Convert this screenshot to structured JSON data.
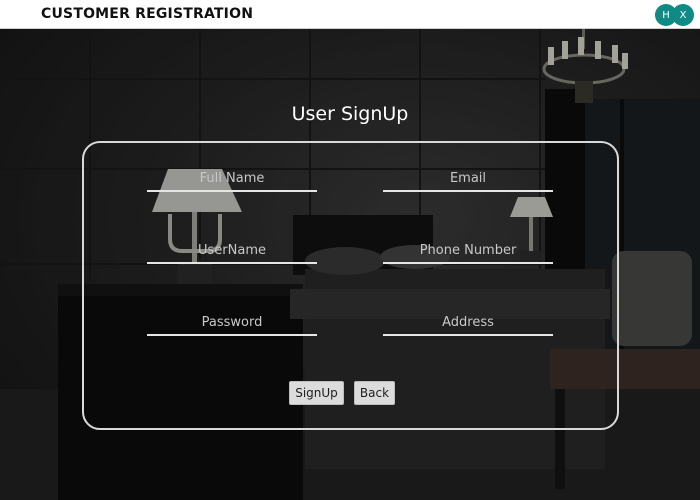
{
  "window": {
    "title": "CUSTOMER REGISTRATION",
    "hide_label": "H",
    "close_label": "X",
    "accent_color": "#0f8a84"
  },
  "form": {
    "heading": "User SignUp",
    "fields": {
      "full_name": {
        "placeholder": "Full Name",
        "value": ""
      },
      "email": {
        "placeholder": "Email",
        "value": ""
      },
      "username": {
        "placeholder": "UserName",
        "value": ""
      },
      "phone": {
        "placeholder": "Phone Number",
        "value": ""
      },
      "password": {
        "placeholder": "Password",
        "value": ""
      },
      "address": {
        "placeholder": "Address",
        "value": ""
      }
    },
    "signup_label": "SignUp",
    "back_label": "Back"
  },
  "background": {
    "scene": "dark hotel bedroom",
    "icons": [
      "chandelier-icon",
      "table-lamp-icon",
      "bed-icon"
    ]
  }
}
